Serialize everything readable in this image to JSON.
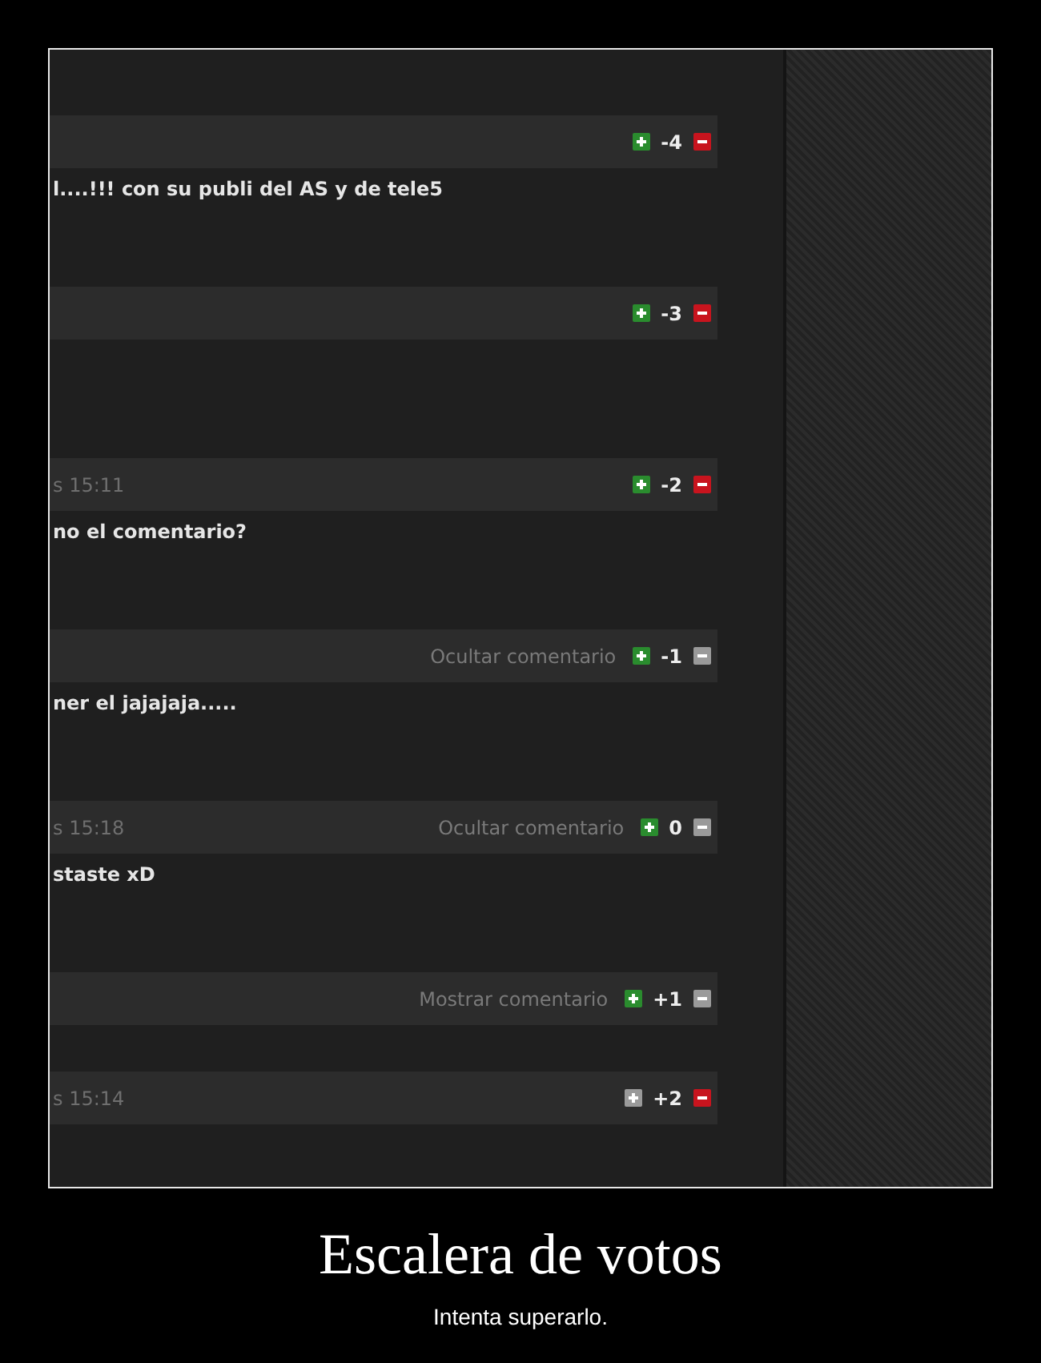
{
  "comments": [
    {
      "score": "-4",
      "up_active": true,
      "down_active": true,
      "hidden": false,
      "body": "l....!!! con su publi del AS y de tele5"
    },
    {
      "score": "-3",
      "up_active": true,
      "down_active": true,
      "hidden": false
    },
    {
      "time": "s 15:11",
      "score": "-2",
      "up_active": true,
      "down_active": true,
      "hidden": false,
      "body": "no el comentario?"
    },
    {
      "toggle": "Ocultar comentario",
      "score": "-1",
      "up_active": true,
      "down_active": false,
      "hidden": false,
      "body": "ner el jajajaja....."
    },
    {
      "time": "s 15:18",
      "toggle": "Ocultar comentario",
      "score": "0",
      "up_active": true,
      "down_active": false,
      "hidden": false,
      "body": "staste xD"
    },
    {
      "toggle": "Mostrar comentario",
      "score": "+1",
      "up_active": true,
      "down_active": false,
      "hidden": true
    },
    {
      "time": "s 15:14",
      "score": "+2",
      "up_active": false,
      "down_active": true,
      "hidden": false
    }
  ],
  "caption": {
    "title": "Escalera de votos",
    "subtitle": "Intenta superarlo."
  }
}
